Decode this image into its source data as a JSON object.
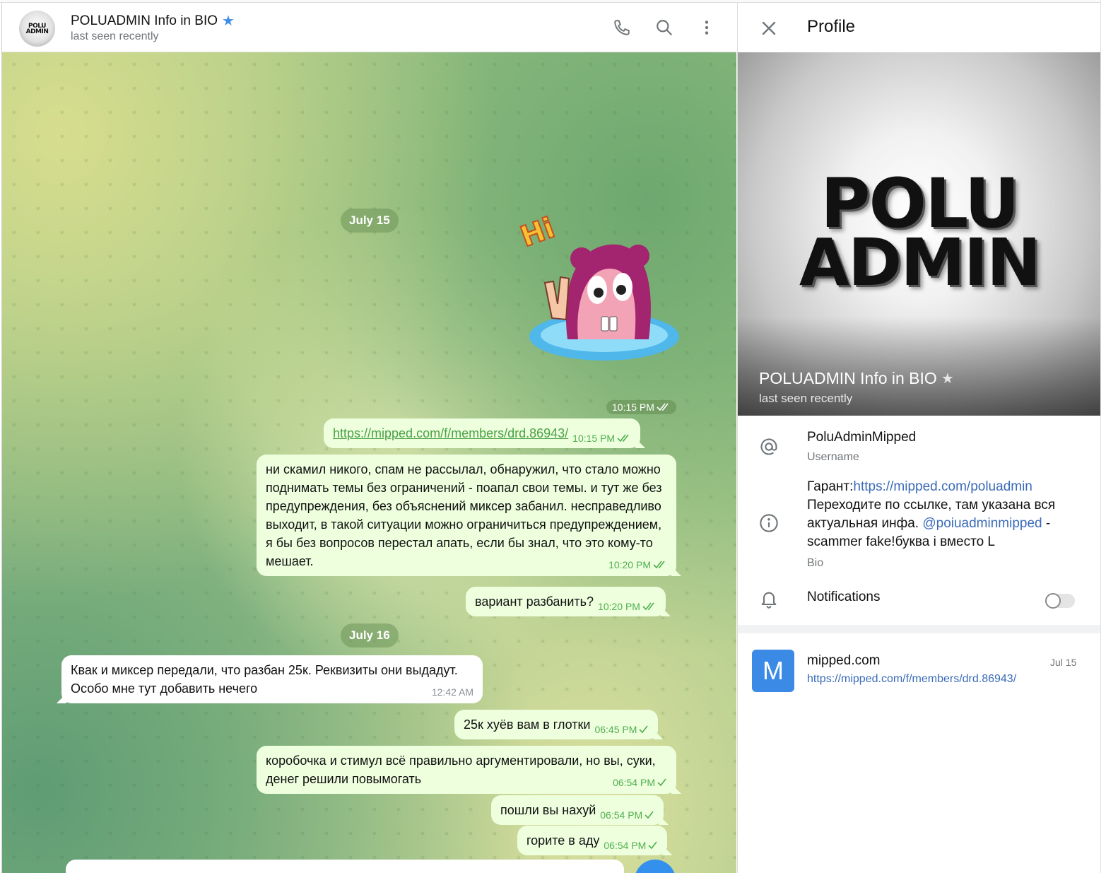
{
  "chat": {
    "title": "POLUADMIN Info in BIO",
    "status": "last seen recently",
    "avatar_text_line1": "POLU",
    "avatar_text_line2": "ADMIN",
    "icons": [
      "phone-icon",
      "search-icon",
      "more-vertical-icon",
      "verified-star-icon"
    ]
  },
  "dates": {
    "first": "July 15",
    "second": "July 16"
  },
  "messages": [
    {
      "kind": "sticker",
      "time": "10:15 PM",
      "sticker_text": "Hi"
    },
    {
      "kind": "out",
      "link": "https://mipped.com/f/members/drd.86943/",
      "time": "10:15 PM"
    },
    {
      "kind": "out",
      "text": "ни скамил никого, спам не рассылал, обнаружил, что стало можно поднимать темы без ограничений -  поапал свои темы. и тут же без предупреждения, без объяснений миксер забанил. несправедливо выходит, в такой ситуации можно ограничиться предупреждением, я бы без вопросов перестал апать, если бы знал, что это кому-то мешает.",
      "time": "10:20 PM"
    },
    {
      "kind": "out",
      "text": "вариант разбанить?",
      "time": "10:20 PM"
    },
    {
      "kind": "in",
      "text": "Квак и миксер передали, что разбан 25к. Реквизиты они выдадут. Особо мне тут добавить нечего",
      "time": "12:42 AM"
    },
    {
      "kind": "out",
      "text": "25к хуёв вам в глотки",
      "time": "06:45 PM"
    },
    {
      "kind": "out",
      "text": "коробочка и стимул всё правильно аргументировали, но вы, суки, денег решили повымогать",
      "time": "06:54 PM"
    },
    {
      "kind": "out",
      "text": "пошли вы нахуй",
      "time": "06:54 PM"
    },
    {
      "kind": "out",
      "text": "горите в аду",
      "time": "06:54 PM"
    }
  ],
  "profile": {
    "title": "Profile",
    "logo_line1": "POLU",
    "logo_line2": "ADMIN",
    "name": "POLUADMIN Info in BIO",
    "status": "last seen recently",
    "username": "PoluAdminMipped",
    "username_label": "Username",
    "bio_prefix": "Гарант:",
    "bio_link": "https://mipped.com/poluadmin",
    "bio_line2": "Переходите по ссылке, там указана вся актуальная инфа. ",
    "bio_mention": "@poiuadminmipped",
    "bio_suffix": " - scammer fake!буква i вместо L",
    "bio_label": "Bio",
    "notifications_label": "Notifications",
    "notifications_on": false,
    "shared_link": {
      "thumb_letter": "M",
      "title": "mipped.com",
      "date": "Jul 15",
      "url": "https://mipped.com/f/members/drd.86943/"
    }
  },
  "colors": {
    "outgoing_bubble": "#eeffde",
    "incoming_bubble": "#ffffff",
    "time_green": "#4fae4e",
    "link_blue": "#3a6bb8",
    "accent": "#3390ec"
  }
}
